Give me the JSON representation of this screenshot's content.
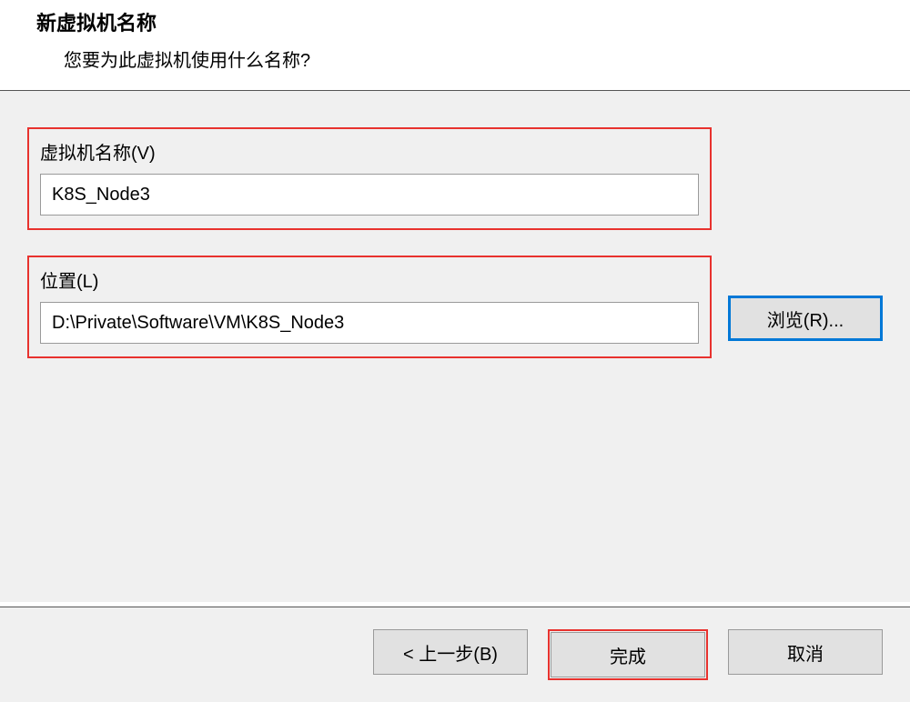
{
  "header": {
    "title": "新虚拟机名称",
    "subtitle": "您要为此虚拟机使用什么名称?"
  },
  "fields": {
    "vm_name": {
      "label": "虚拟机名称(V)",
      "value": "K8S_Node3"
    },
    "location": {
      "label": "位置(L)",
      "value": "D:\\Private\\Software\\VM\\K8S_Node3"
    }
  },
  "buttons": {
    "browse": "浏览(R)...",
    "back": "< 上一步(B)",
    "finish": "完成",
    "cancel": "取消"
  }
}
